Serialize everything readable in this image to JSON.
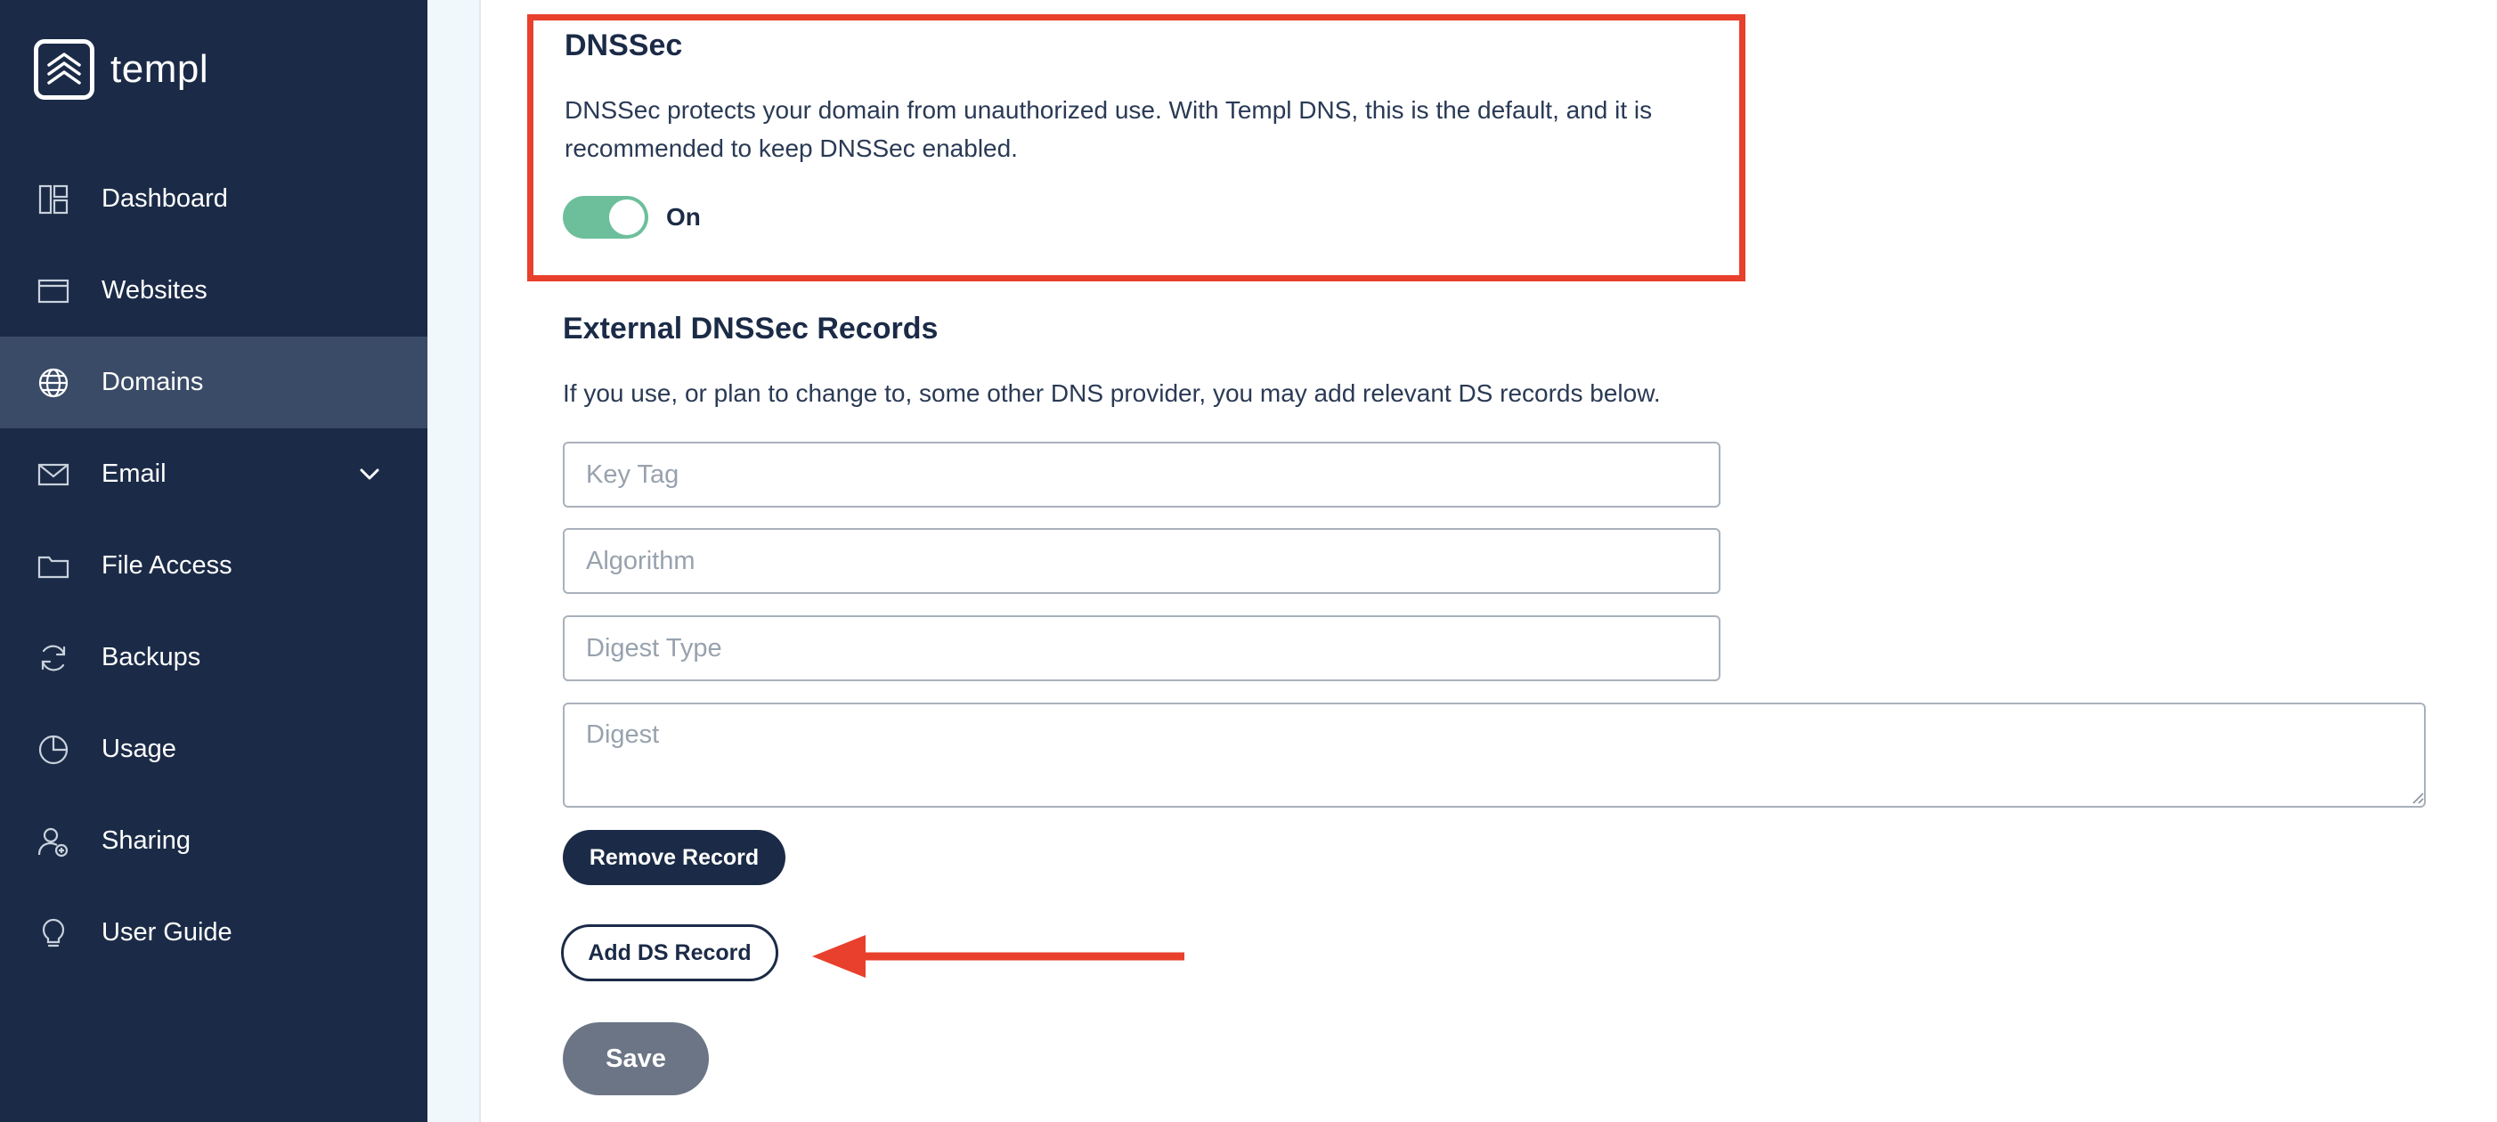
{
  "app": {
    "brand": "templ"
  },
  "sidebar": {
    "items": [
      {
        "label": "Dashboard",
        "icon": "dashboard-icon",
        "active": false
      },
      {
        "label": "Websites",
        "icon": "websites-icon",
        "active": false
      },
      {
        "label": "Domains",
        "icon": "globe-icon",
        "active": true
      },
      {
        "label": "Email",
        "icon": "envelope-icon",
        "active": false,
        "expandable": true
      },
      {
        "label": "File Access",
        "icon": "folder-icon",
        "active": false
      },
      {
        "label": "Backups",
        "icon": "refresh-icon",
        "active": false
      },
      {
        "label": "Usage",
        "icon": "pie-chart-icon",
        "active": false
      },
      {
        "label": "Sharing",
        "icon": "user-share-icon",
        "active": false
      },
      {
        "label": "User Guide",
        "icon": "lightbulb-icon",
        "active": false
      }
    ]
  },
  "dnssec": {
    "title": "DNSSec",
    "description_line1": "DNSSec protects your domain from unauthorized use. With Templ DNS, this is the default, and it is",
    "description_line2": "recommended to keep DNSSec enabled.",
    "toggle_state": "On",
    "enabled": true
  },
  "external": {
    "title": "External DNSSec Records",
    "description": "If you use, or plan to change to, some other DNS provider, you may add relevant DS records below.",
    "fields": {
      "key_tag_placeholder": "Key Tag",
      "algorithm_placeholder": "Algorithm",
      "digest_type_placeholder": "Digest Type",
      "digest_placeholder": "Digest"
    }
  },
  "buttons": {
    "remove_record": "Remove Record",
    "add_ds_record": "Add DS Record",
    "save": "Save"
  },
  "colors": {
    "sidebar_bg": "#1b2b47",
    "sidebar_active": "#3a4b67",
    "highlight": "#e8402c",
    "toggle_on": "#6dbf9c",
    "save_disabled": "#6b7585"
  }
}
